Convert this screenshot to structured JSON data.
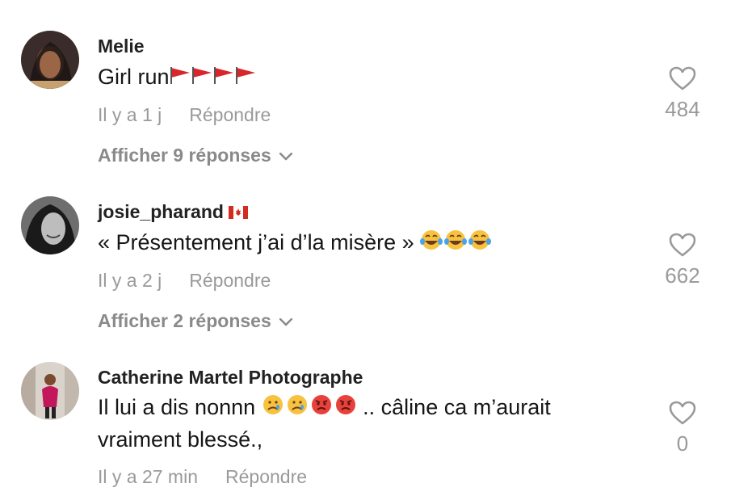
{
  "comments": [
    {
      "username": "Melie",
      "text": "Girl run",
      "emoji": [
        "triangular-flag",
        "triangular-flag",
        "triangular-flag",
        "triangular-flag"
      ],
      "time": "Il y a 1 j",
      "reply_label": "Répondre",
      "replies_label": "Afficher 9 réponses",
      "likes": "484"
    },
    {
      "username": "josie_pharand",
      "badge": "canada-flag",
      "text": "« Présentement j’ai d’la misère »",
      "emoji": [
        "tears-of-joy",
        "tears-of-joy",
        "tears-of-joy"
      ],
      "time": "Il y a 2 j",
      "reply_label": "Répondre",
      "replies_label": "Afficher 2 réponses",
      "likes": "662"
    },
    {
      "username": "Catherine Martel Photographe",
      "text_before": "Il lui a dis nonnn",
      "emoji": [
        "crying-face",
        "crying-face",
        "angry-face",
        "angry-face"
      ],
      "text_after": " .. câline ca m’aurait vraiment blessé.,",
      "time": "Il y a 27 min",
      "reply_label": "Répondre",
      "likes": "0"
    }
  ],
  "colors": {
    "username": "#222222",
    "text": "#161616",
    "muted": "#9a9a9a"
  }
}
